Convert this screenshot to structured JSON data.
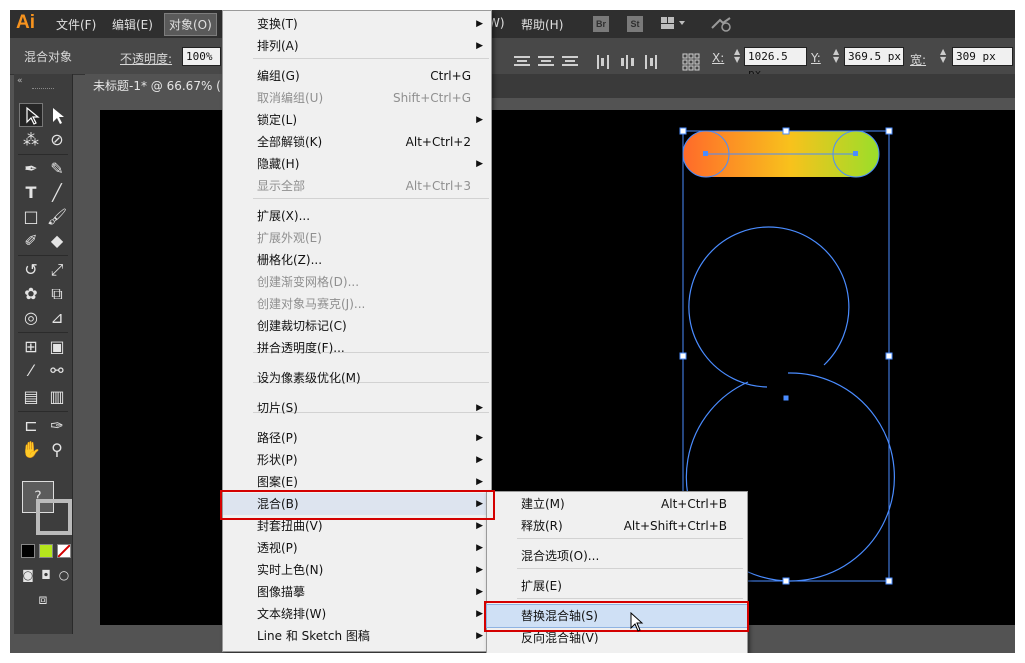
{
  "app": {
    "logo": "Ai"
  },
  "menubar": {
    "items": [
      "文件(F)",
      "编辑(E)",
      "对象(O)",
      "W)",
      "帮助(H)"
    ],
    "bridge_label": "Br",
    "stock_label": "St"
  },
  "control_bar": {
    "selection_label": "混合对象",
    "opacity_label": "不透明度:",
    "opacity_value": "100%",
    "x_label": "X:",
    "x_value": "1026.5 px",
    "y_label": "Y:",
    "y_value": "369.5 px",
    "w_label": "宽:",
    "w_value": "309 px"
  },
  "document_tab": {
    "title": "未标题-1* @ 66.67% ("
  },
  "object_menu": {
    "items": [
      {
        "label": "变换(T)",
        "shortcut": "",
        "submenu": true,
        "disabled": false
      },
      {
        "label": "排列(A)",
        "shortcut": "",
        "submenu": true,
        "disabled": false
      },
      {
        "label": "编组(G)",
        "shortcut": "Ctrl+G",
        "submenu": false,
        "disabled": false
      },
      {
        "label": "取消编组(U)",
        "shortcut": "Shift+Ctrl+G",
        "submenu": false,
        "disabled": true
      },
      {
        "label": "锁定(L)",
        "shortcut": "",
        "submenu": true,
        "disabled": false
      },
      {
        "label": "全部解锁(K)",
        "shortcut": "Alt+Ctrl+2",
        "submenu": false,
        "disabled": false
      },
      {
        "label": "隐藏(H)",
        "shortcut": "",
        "submenu": true,
        "disabled": false
      },
      {
        "label": "显示全部",
        "shortcut": "Alt+Ctrl+3",
        "submenu": false,
        "disabled": true
      },
      {
        "label": "扩展(X)...",
        "shortcut": "",
        "submenu": false,
        "disabled": false
      },
      {
        "label": "扩展外观(E)",
        "shortcut": "",
        "submenu": false,
        "disabled": true
      },
      {
        "label": "栅格化(Z)...",
        "shortcut": "",
        "submenu": false,
        "disabled": false
      },
      {
        "label": "创建渐变网格(D)...",
        "shortcut": "",
        "submenu": false,
        "disabled": true
      },
      {
        "label": "创建对象马赛克(J)...",
        "shortcut": "",
        "submenu": false,
        "disabled": true
      },
      {
        "label": "创建裁切标记(C)",
        "shortcut": "",
        "submenu": false,
        "disabled": false
      },
      {
        "label": "拼合透明度(F)...",
        "shortcut": "",
        "submenu": false,
        "disabled": false
      },
      {
        "label": "设为像素级优化(M)",
        "shortcut": "",
        "submenu": false,
        "disabled": false
      },
      {
        "label": "切片(S)",
        "shortcut": "",
        "submenu": true,
        "disabled": false
      },
      {
        "label": "路径(P)",
        "shortcut": "",
        "submenu": true,
        "disabled": false
      },
      {
        "label": "形状(P)",
        "shortcut": "",
        "submenu": true,
        "disabled": false
      },
      {
        "label": "图案(E)",
        "shortcut": "",
        "submenu": true,
        "disabled": false
      },
      {
        "label": "混合(B)",
        "shortcut": "",
        "submenu": true,
        "disabled": false
      },
      {
        "label": "封套扭曲(V)",
        "shortcut": "",
        "submenu": true,
        "disabled": false
      },
      {
        "label": "透视(P)",
        "shortcut": "",
        "submenu": true,
        "disabled": false
      },
      {
        "label": "实时上色(N)",
        "shortcut": "",
        "submenu": true,
        "disabled": false
      },
      {
        "label": "图像描摹",
        "shortcut": "",
        "submenu": true,
        "disabled": false
      },
      {
        "label": "文本绕排(W)",
        "shortcut": "",
        "submenu": true,
        "disabled": false
      },
      {
        "label": "Line 和 Sketch 图稿",
        "shortcut": "",
        "submenu": true,
        "disabled": false
      }
    ]
  },
  "blend_submenu": {
    "items": [
      {
        "label": "建立(M)",
        "shortcut": "Alt+Ctrl+B"
      },
      {
        "label": "释放(R)",
        "shortcut": "Alt+Shift+Ctrl+B"
      },
      {
        "label": "混合选项(O)...",
        "shortcut": ""
      },
      {
        "label": "扩展(E)",
        "shortcut": ""
      },
      {
        "label": "替换混合轴(S)",
        "shortcut": ""
      },
      {
        "label": "反向混合轴(V)",
        "shortcut": ""
      }
    ]
  },
  "toolbar": {
    "unknown_fill": "?"
  },
  "colors": {
    "highlight_box": "#d40000",
    "path_selection": "#4a8cff",
    "gradient_start": "#ff6a2a",
    "gradient_mid": "#f8c21c",
    "gradient_end": "#9ade2a"
  },
  "icons": [
    "select-arrow-icon",
    "direct-select-icon",
    "pen-icon",
    "type-icon",
    "rectangle-icon",
    "brush-icon",
    "rotate-icon",
    "scale-icon",
    "hand-icon",
    "zoom-icon",
    "eyedropper-icon",
    "gradient-icon"
  ]
}
